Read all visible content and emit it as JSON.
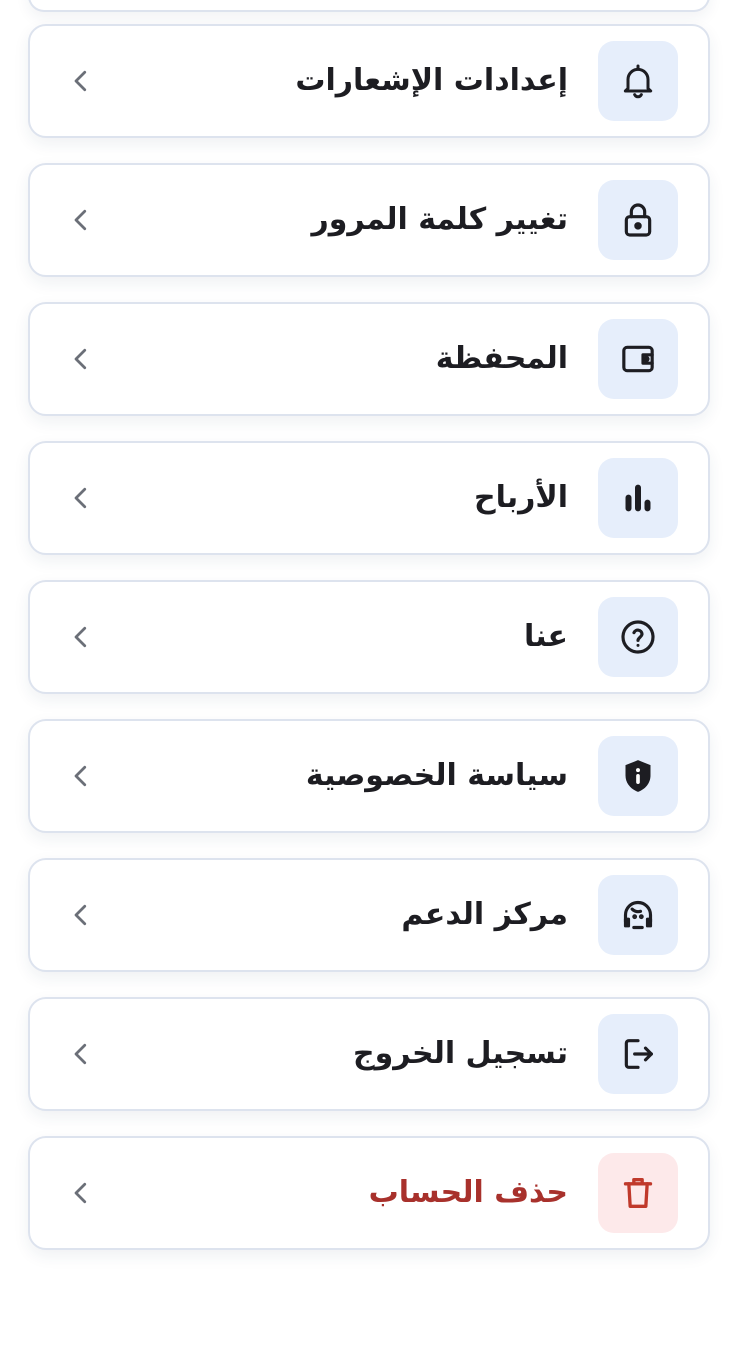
{
  "menu": {
    "items": [
      {
        "label": "إعدادات الإشعارات",
        "icon": "bell-icon"
      },
      {
        "label": "تغيير كلمة المرور",
        "icon": "lock-icon"
      },
      {
        "label": "المحفظة",
        "icon": "wallet-icon"
      },
      {
        "label": "الأرباح",
        "icon": "bar-chart-icon"
      },
      {
        "label": "عنا",
        "icon": "question-circle-icon"
      },
      {
        "label": "سياسة الخصوصية",
        "icon": "shield-info-icon"
      },
      {
        "label": "مركز الدعم",
        "icon": "headset-icon"
      },
      {
        "label": "تسجيل الخروج",
        "icon": "logout-icon"
      },
      {
        "label": "حذف الحساب",
        "icon": "trash-icon"
      }
    ]
  },
  "colors": {
    "text": "#1d1d22",
    "danger_text": "#a8312c",
    "icon_bg": "#e6eefb",
    "danger_icon_bg": "#fde9ea",
    "card_border": "#dde3ee",
    "chevron": "#6b6f78"
  }
}
